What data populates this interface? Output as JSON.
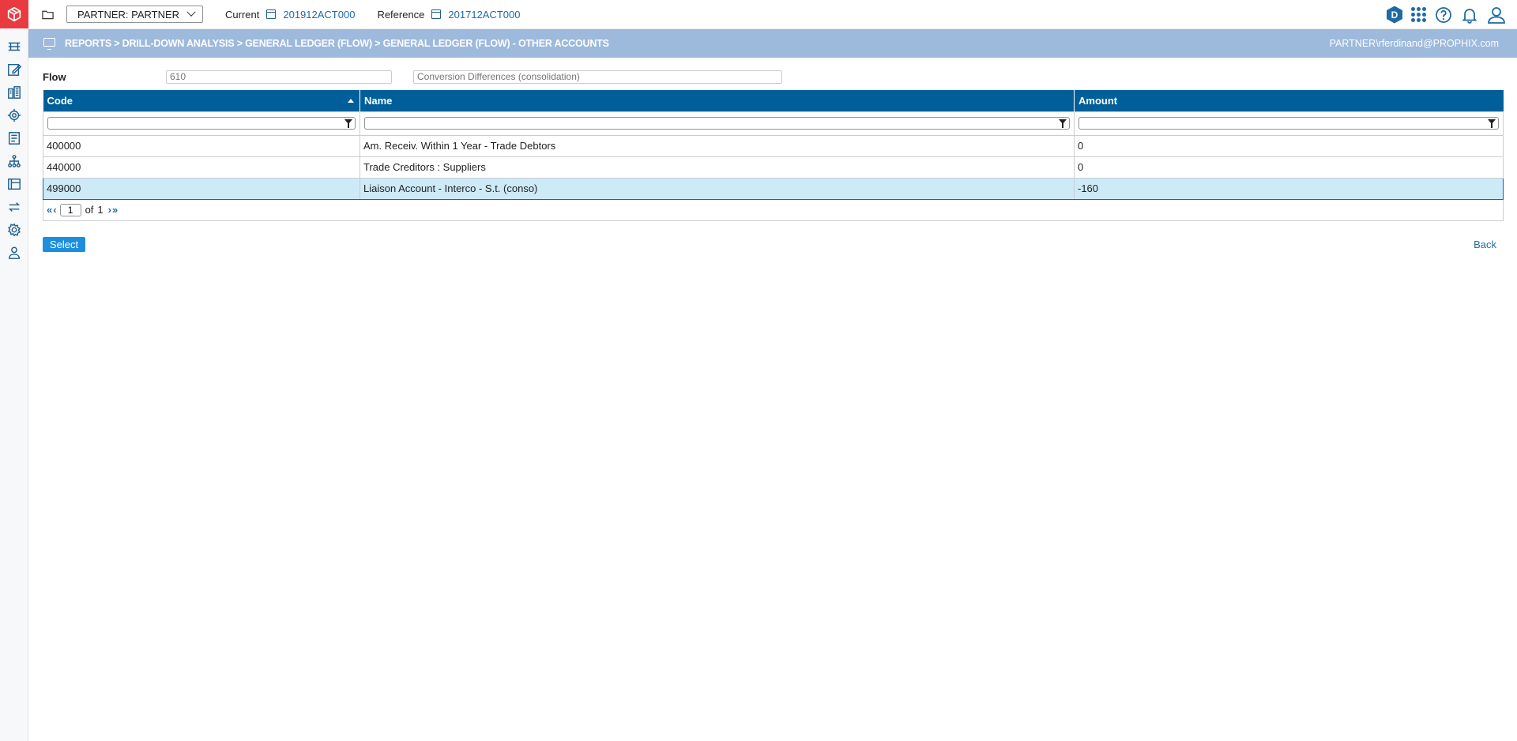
{
  "colors": {
    "brand_red": "#e83a3f",
    "accent_blue": "#1e6aa5",
    "header_blue": "#005f99",
    "banner_blue": "#9db9dc",
    "selected_row": "#cdeaf7",
    "button_blue": "#1c8ee0"
  },
  "rail": {
    "icons": [
      "reports-icon",
      "edit-icon",
      "organization-icon",
      "consolidation-icon",
      "journal-icon",
      "hierarchy-icon",
      "package-icon",
      "transfer-icon",
      "settings-icon",
      "users-icon"
    ]
  },
  "topbar": {
    "partner_select": "PARTNER: PARTNER",
    "current_label": "Current",
    "current_value": "201912ACT000",
    "reference_label": "Reference",
    "reference_value": "201712ACT000",
    "badge_letter": "D"
  },
  "banner": {
    "breadcrumb": "REPORTS > DRILL-DOWN ANALYSIS > GENERAL LEDGER (FLOW) > GENERAL LEDGER (FLOW) - OTHER ACCOUNTS",
    "user": "PARTNER\\rferdinand@PROPHIX.com"
  },
  "flow": {
    "label": "Flow",
    "code_placeholder": "610",
    "name_placeholder": "Conversion Differences (consolidation)"
  },
  "table": {
    "headers": {
      "code": "Code",
      "name": "Name",
      "amount": "Amount"
    },
    "rows": [
      {
        "code": "400000",
        "name": "Am. Receiv. Within 1 Year - Trade Debtors",
        "amount": "0"
      },
      {
        "code": "440000",
        "name": "Trade Creditors : Suppliers",
        "amount": "0"
      },
      {
        "code": "499000",
        "name": "Liaison Account - Interco - S.t. (conso)",
        "amount": "-160"
      }
    ],
    "pager": {
      "page": "1",
      "of_label": "of",
      "total_pages": "1"
    }
  },
  "actions": {
    "select_label": "Select",
    "back_label": "Back"
  }
}
